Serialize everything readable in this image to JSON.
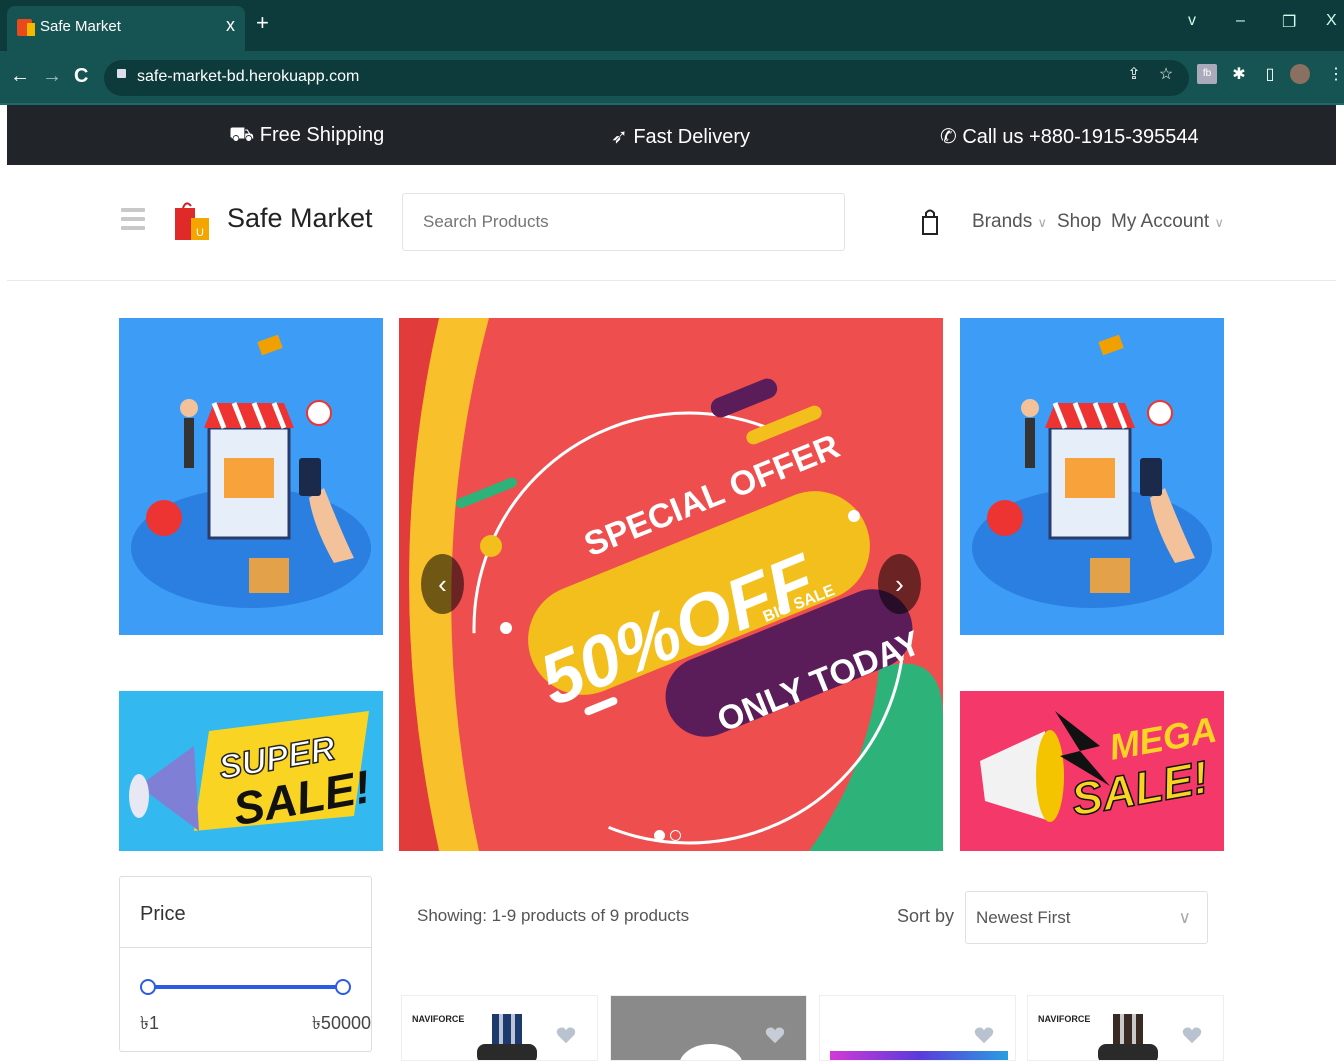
{
  "browser": {
    "tab_title": "Safe Market",
    "tab_close": "x",
    "new_tab": "+",
    "url": "safe-market-bd.herokuapp.com",
    "win_controls": [
      "v",
      "–",
      "❐",
      "X"
    ]
  },
  "promo_bar": {
    "free_shipping": "Free Shipping",
    "fast_delivery": "Fast Delivery",
    "call_us": "Call us +880-1915-395544"
  },
  "header": {
    "brand": "Safe Market",
    "search_placeholder": "Search Products",
    "menu": {
      "brands": "Brands",
      "shop": "Shop",
      "account": "My Account"
    }
  },
  "hero": {
    "special_offer": "SPECIAL OFFER",
    "discount": "50%OFF",
    "big_sale": "BIG SALE",
    "only_today": "ONLY TODAY",
    "super_sale_1": "SUPER",
    "super_sale_2": "SALE!",
    "mega_sale_1": "MEGA",
    "mega_sale_2": "SALE!",
    "slide_count": 2,
    "active_slide": 1
  },
  "filter": {
    "price_title": "Price",
    "min_label": "৳1",
    "max_label": "৳50000"
  },
  "listing": {
    "showing": "Showing: 1-9 products of 9 products",
    "sort_label": "Sort by",
    "sort_value": "Newest First"
  },
  "products": [
    {
      "brand": "NAVIFORCE"
    },
    {
      "brand": ""
    },
    {
      "brand": ""
    },
    {
      "brand": "NAVIFORCE"
    }
  ],
  "colors": {
    "topbar": "#212529",
    "accent": "#2d5be3",
    "chrome": "#165453",
    "carousel": "#ef4e4e"
  }
}
